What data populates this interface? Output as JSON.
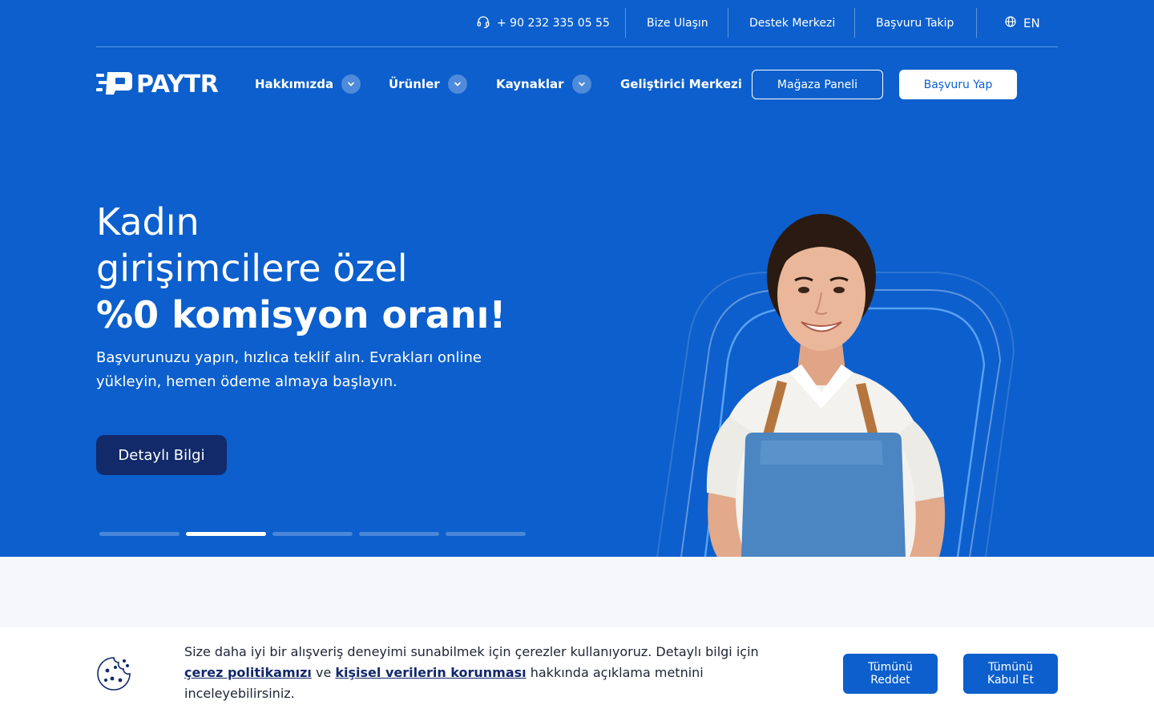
{
  "topbar": {
    "phone": "+ 90 232 335 05 55",
    "links": [
      "Bize Ulaşın",
      "Destek Merkezi",
      "Başvuru Takip"
    ],
    "language": "EN"
  },
  "brand": {
    "name": "PAYTR"
  },
  "nav": {
    "items": [
      {
        "label": "Hakkımızda",
        "has_dropdown": true
      },
      {
        "label": "Ürünler",
        "has_dropdown": true
      },
      {
        "label": "Kaynaklar",
        "has_dropdown": true
      },
      {
        "label": "Geliştirici Merkezi",
        "has_dropdown": false
      }
    ],
    "store_panel": "Mağaza Paneli",
    "apply": "Başvuru Yap"
  },
  "hero": {
    "title_line1": "Kadın",
    "title_line2": "girişimcilere özel",
    "title_line3": "%0 komisyon oranı!",
    "subtitle": "Başvurunuzu yapın, hızlıca teklif alın. Evrakları online yükleyin, hemen ödeme almaya başlayın.",
    "cta": "Detaylı Bilgi",
    "slides_total": 5,
    "active_slide": 2
  },
  "cookie": {
    "text_before": "Size daha iyi bir alışveriş deneyimi sunabilmek için çerezler kullanıyoruz. Detaylı bilgi için ",
    "link1": "çerez politikamızı",
    "text_mid": " ve ",
    "link2": "kişisel verilerin korunması",
    "text_after": " hakkında açıklama metnini inceleyebilirsiniz.",
    "reject_all": "Tümünü Reddet",
    "accept_all": "Tümünü Kabul Et"
  },
  "colors": {
    "brand_blue": "#0c5fcc",
    "dark_navy": "#122a6a",
    "page_bg": "#f6f7fa"
  }
}
